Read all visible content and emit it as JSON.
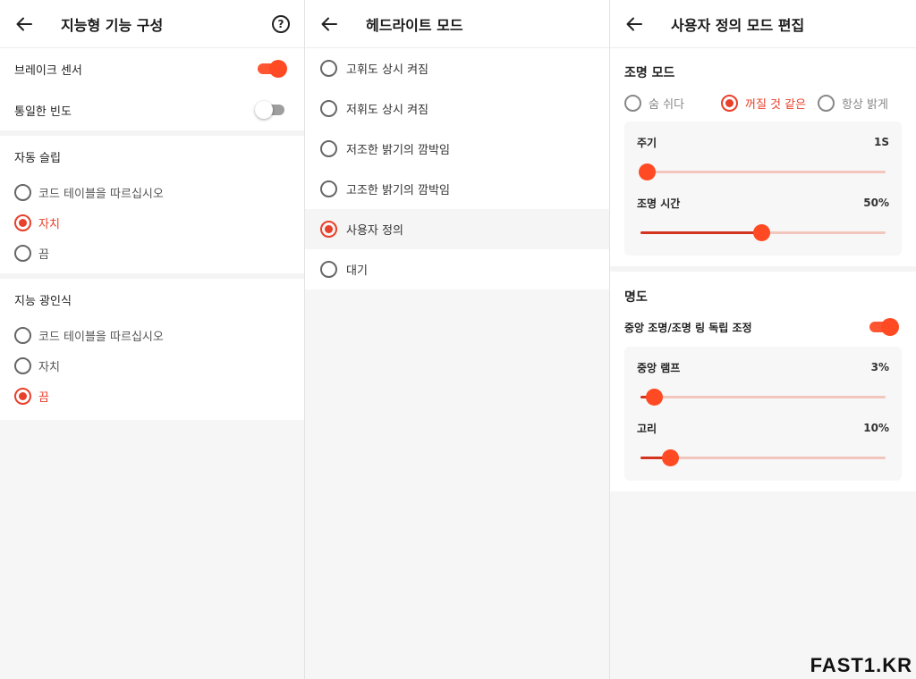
{
  "panel1": {
    "title": "지능형 기능 구성",
    "help_icon": "?",
    "brake_sensor": {
      "label": "브레이크 센서",
      "on": true
    },
    "same_frequency": {
      "label": "통일한 빈도",
      "on": false
    },
    "auto_sleep": {
      "title": "자동 슬립",
      "options": [
        "코드 테이블을 따르십시오",
        "자치",
        "끔"
      ],
      "selected_index": 1
    },
    "smart_light": {
      "title": "지능 광인식",
      "options": [
        "코드 테이블을 따르십시오",
        "자치",
        "끔"
      ],
      "selected_index": 2
    }
  },
  "panel2": {
    "title": "헤드라이트 모드",
    "modes": [
      "고휘도 상시 켜짐",
      "저휘도 상시 켜짐",
      "저조한 밝기의 깜박임",
      "고조한 밝기의 깜박임",
      "사용자 정의",
      "대기"
    ],
    "selected_index": 4
  },
  "panel3": {
    "title": "사용자 정의 모드 편집",
    "light_mode": {
      "title": "조명 모드",
      "options": [
        "숨 쉬다",
        "꺼질 것 같은",
        "항상 밝게"
      ],
      "selected_index": 1
    },
    "period": {
      "label": "주기",
      "value": "1S",
      "percent": 0
    },
    "light_time": {
      "label": "조명 시간",
      "value": "50%",
      "percent": 50
    },
    "brightness": {
      "title": "명도",
      "independent": {
        "label": "중앙 조명/조명 링 독립 조정",
        "on": true
      },
      "center_lamp": {
        "label": "중앙 램프",
        "value": "3%",
        "percent": 3
      },
      "ring": {
        "label": "고리",
        "value": "10%",
        "percent": 10
      }
    }
  },
  "watermark": "FAST1.KR",
  "colors": {
    "accent": "#e8402a",
    "toggle_on": "#ff4a23",
    "track": "#f3c6bd"
  },
  "icons": {
    "back": "arrow-left-icon",
    "help": "question-circle-icon"
  }
}
